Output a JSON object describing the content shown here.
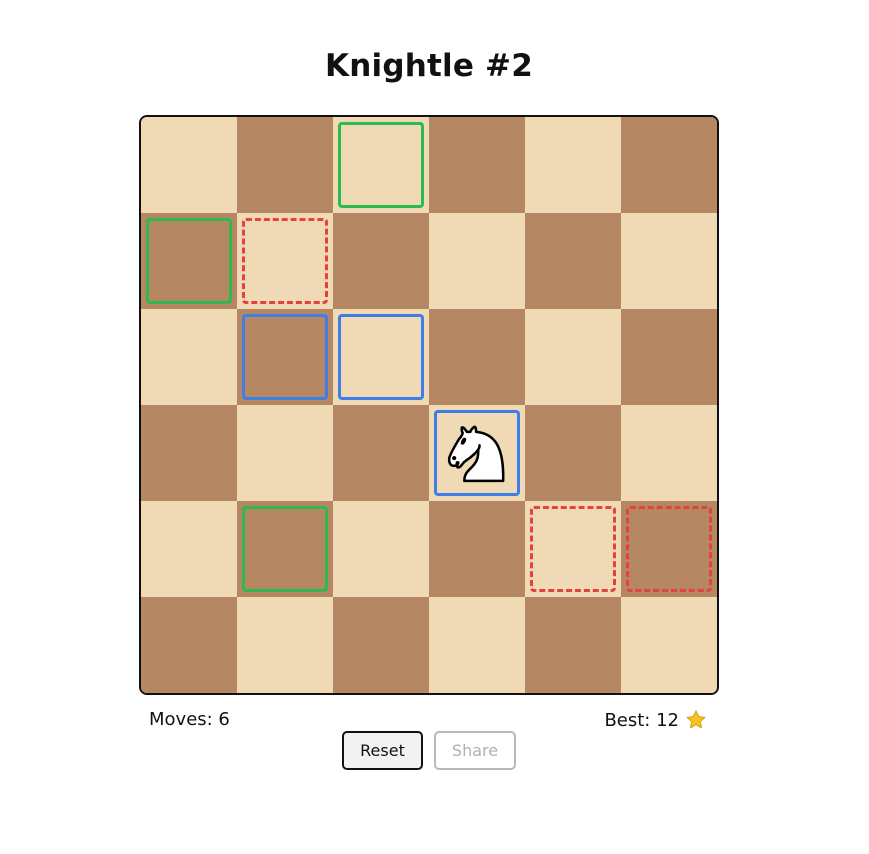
{
  "header": {
    "title": "Knightle #2"
  },
  "board": {
    "size": 6,
    "colors": {
      "light": "#f0d9b5",
      "dark": "#b58863",
      "target_marker": "#2dba4e",
      "path_marker": "#3f7ee6",
      "blocked_marker": "#e5413f"
    },
    "knight": {
      "row": 3,
      "col": 3,
      "piece": "white-knight"
    },
    "highlights": [
      {
        "row": 0,
        "col": 2,
        "type": "green"
      },
      {
        "row": 1,
        "col": 0,
        "type": "green"
      },
      {
        "row": 4,
        "col": 1,
        "type": "green"
      },
      {
        "row": 2,
        "col": 1,
        "type": "blue"
      },
      {
        "row": 2,
        "col": 2,
        "type": "blue"
      },
      {
        "row": 3,
        "col": 3,
        "type": "blue"
      },
      {
        "row": 1,
        "col": 1,
        "type": "red"
      },
      {
        "row": 4,
        "col": 4,
        "type": "red"
      },
      {
        "row": 4,
        "col": 5,
        "type": "red"
      }
    ]
  },
  "status": {
    "moves_label": "Moves: 6",
    "best_label": "Best: 12",
    "best_icon": "star-icon"
  },
  "controls": {
    "reset_label": "Reset",
    "share_label": "Share",
    "share_enabled": false
  }
}
